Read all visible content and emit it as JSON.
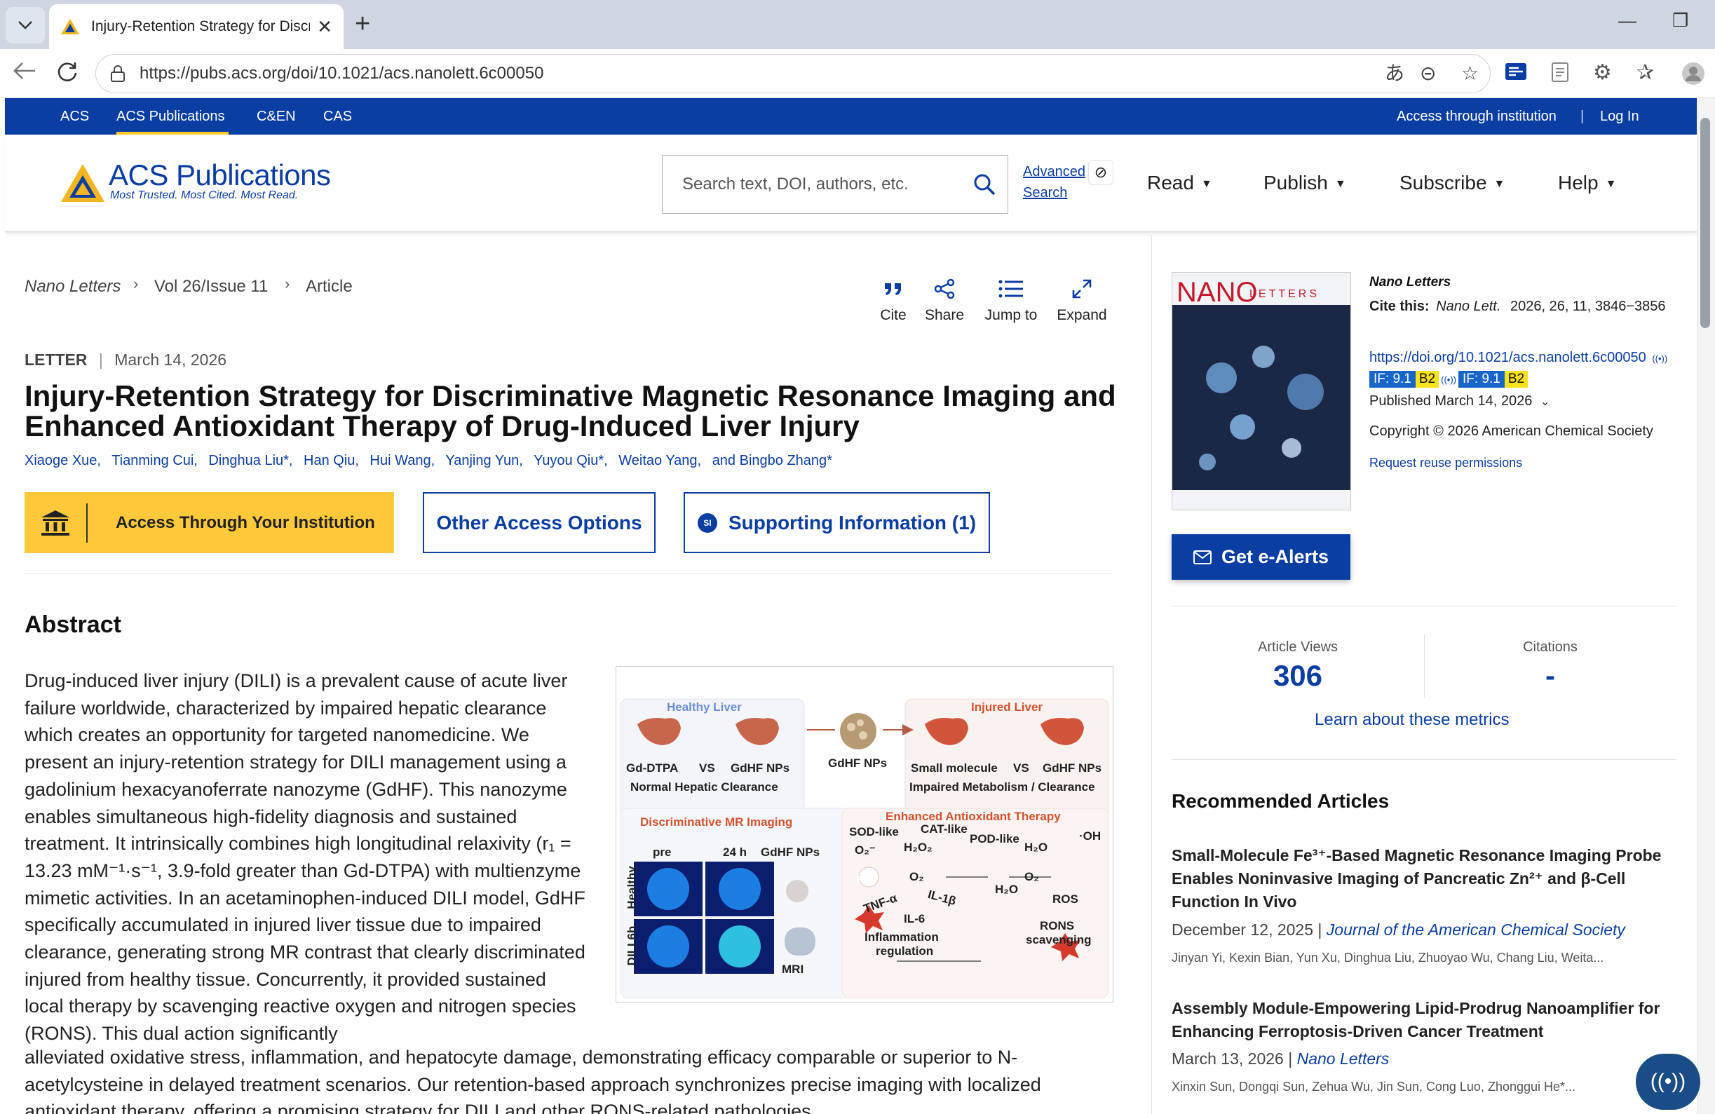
{
  "browser": {
    "tab_title": "Injury-Retention Strategy for Discri",
    "tab_close": "✕",
    "new_tab": "+",
    "url": "https://pubs.acs.org/doi/10.1021/acs.nanolett.6c00050"
  },
  "topbar": {
    "links": [
      "ACS",
      "ACS Publications",
      "C&EN",
      "CAS"
    ],
    "active": "ACS Publications",
    "access_institution": "Access through institution",
    "sep": "|",
    "login": "Log In"
  },
  "header": {
    "logo_main": "ACS Publications",
    "logo_tagline": "Most Trusted. Most Cited. Most Read.",
    "search_placeholder": "Search text, DOI, authors, etc.",
    "advanced_line1": "Advanced",
    "advanced_line2": "Search",
    "nav": [
      "Read",
      "Publish",
      "Subscribe",
      "Help"
    ]
  },
  "breadcrumb": {
    "journal": "Nano Letters",
    "issue": "Vol 26/Issue 11",
    "type": "Article"
  },
  "tools": [
    "Cite",
    "Share",
    "Jump to",
    "Expand"
  ],
  "article": {
    "type": "LETTER",
    "sep": "|",
    "date": "March 14, 2026",
    "title": "Injury-Retention Strategy for Discriminative Magnetic Resonance Imaging and Enhanced Antioxidant Therapy of Drug-Induced Liver Injury",
    "authors": [
      "Xiaoge Xue,",
      "Tianming Cui,",
      "Dinghua Liu*,",
      "Han Qiu,",
      "Hui Wang,",
      "Yanjing Yun,",
      "Yuyou Qiu*,",
      "Weitao Yang,",
      "and  Bingbo Zhang*"
    ],
    "access_btn": "Access Through Your Institution",
    "other_btn": "Other Access Options",
    "si_badge": "SI",
    "si_btn": "Supporting Information (1)",
    "abstract_heading": "Abstract",
    "abstract_p1": "Drug-induced liver injury (DILI) is a prevalent cause of acute liver failure worldwide, characterized by impaired hepatic clearance which creates an opportunity for targeted nanomedicine. We present an injury-retention strategy for DILI management using a gadolinium hexacyanoferrate nanozyme (GdHF). This nanozyme enables simultaneous high-fidelity diagnosis and sustained treatment. It intrinsically combines high longitudinal relaxivity (r₁ = 13.23 mM⁻¹·s⁻¹, 3.9-fold greater than Gd-DTPA) with multienzyme mimetic activities. In an acetaminophen-induced DILI model, GdHF specifically accumulated in injured liver tissue due to impaired clearance, generating strong MR contrast that clearly discriminated injured from healthy tissue. Concurrently, it provided sustained local therapy by scavenging reactive oxygen and nitrogen species (RONS). This dual action significantly",
    "abstract_p2": "alleviated oxidative stress, inflammation, and hepatocyte damage, demonstrating efficacy comparable or superior to N-acetylcysteine in delayed treatment scenarios. Our retention-based approach synchronizes precise imaging with localized antioxidant therapy, offering a promising strategy for DILI and other RONS-related pathologies."
  },
  "figure": {
    "healthy_liver": "Healthy Liver",
    "injured_liver": "Injured Liver",
    "gd_dtpa": "Gd-DTPA",
    "vs": "VS",
    "gdhf_nps": "GdHF NPs",
    "normal_clearance": "Normal Hepatic Clearance",
    "small_molecule": "Small molecule",
    "impaired": "Impaired Metabolism / Clearance",
    "disc_mr": "Discriminative MR Imaging",
    "pre": "pre",
    "h24": "24 h",
    "healthy": "Healthy",
    "dili": "DILI 6h",
    "mri": "MRI",
    "therapy": "Enhanced Antioxidant Therapy",
    "sod": "SOD-like",
    "cat": "CAT-like",
    "pod": "POD-like",
    "o2m": "O₂⁻",
    "h2o2": "H₂O₂",
    "h2o": "H₂O",
    "o2": "O₂",
    "oh": "·OH",
    "ros": "ROS",
    "tnf": "TNF-α",
    "il1": "IL-1β",
    "il6": "IL-6",
    "inflam": "Inflammation",
    "regulation": "regulation",
    "rons": "RONS",
    "scavenging": "scavenging"
  },
  "sidebar": {
    "cover_title": "NANO",
    "cover_sub": "LETTERS",
    "journal": "Nano Letters",
    "cite_label": "Cite this:",
    "cite_journal": "Nano Lett.",
    "cite_ref": "2026, 26, 11, 3846−3856",
    "doi": "https://doi.org/10.1021/acs.nanolett.6c00050",
    "if_badge": "IF: 9.1",
    "if_rank": "B2",
    "published": "Published March 14, 2026",
    "copyright": "Copyright © 2026 American Chemical Society",
    "reuse": "Request reuse permissions",
    "alerts_btn": "Get e-Alerts",
    "views_label": "Article Views",
    "views_value": "306",
    "citations_label": "Citations",
    "citations_value": "-",
    "learn": "Learn about these metrics",
    "recommended": "Recommended Articles",
    "rec": [
      {
        "title": "Small-Molecule Fe³⁺-Based Magnetic Resonance Imaging Probe Enables Noninvasive Imaging of Pancreatic Zn²⁺ and β-Cell Function In Vivo",
        "date": "December 12, 2025",
        "journal": "Journal of the American Chemical Society",
        "authors": "Jinyan Yi, Kexin Bian, Yun Xu, Dinghua Liu, Zhuoyao Wu, Chang Liu, Weita..."
      },
      {
        "title": "Assembly Module-Empowering Lipid-Prodrug Nanoamplifier for Enhancing Ferroptosis-Driven Cancer Treatment",
        "date": "March 13, 2026",
        "journal": "Nano Letters",
        "authors": "Xinxin Sun, Dongqi Sun, Zehua Wu, Jin Sun, Cong Luo, Zhonggui He*..."
      }
    ]
  },
  "colors": {
    "brand": "#0a3ea3",
    "accent": "#ffc72c"
  }
}
